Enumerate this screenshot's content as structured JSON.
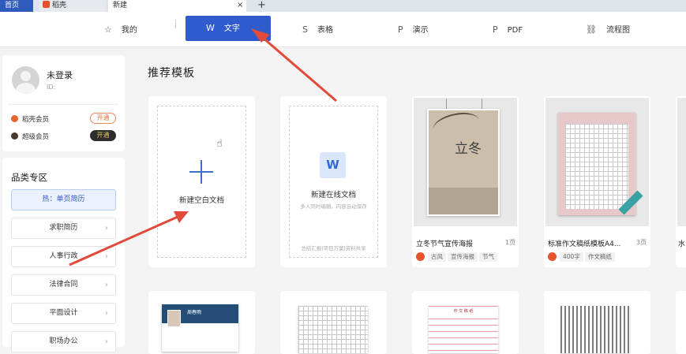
{
  "tabs": [
    {
      "label": "首页"
    },
    {
      "label": "稻壳"
    },
    {
      "label": "新建"
    }
  ],
  "tab_close": "×",
  "tab_add": "+",
  "nav": [
    {
      "label": "我的",
      "icon": "star-icon",
      "glyph": "☆"
    },
    {
      "label": "文字",
      "icon": "writer-icon",
      "glyph": "W",
      "active": true
    },
    {
      "label": "表格",
      "icon": "spreadsheet-icon",
      "glyph": "S"
    },
    {
      "label": "演示",
      "icon": "presentation-icon",
      "glyph": "P"
    },
    {
      "label": "PDF",
      "icon": "pdf-icon",
      "glyph": "P"
    },
    {
      "label": "流程图",
      "icon": "flowchart-icon",
      "glyph": "⛓"
    }
  ],
  "user": {
    "name": "未登录",
    "id_label": "ID:"
  },
  "memberships": [
    {
      "label": "稻壳会员",
      "button": "开通",
      "color": "#e5632d"
    },
    {
      "label": "超级会员",
      "button": "开通",
      "color": "#4a3a2a"
    }
  ],
  "categories": {
    "title": "品类专区",
    "hot": "热：单页简历",
    "items": [
      "求职简历",
      "人事行政",
      "法律合同",
      "平面设计",
      "职场办公"
    ],
    "chevron": "›"
  },
  "section_title": "推荐模板",
  "blank_doc": {
    "label": "新建空白文档"
  },
  "online_doc": {
    "label": "新建在线文档",
    "icon_glyph": "W",
    "subtitle": "多人同时编辑，内容自动保存",
    "footer": "总结汇报|项目方案|资料共享"
  },
  "templates": [
    {
      "name": "立冬节气宣传海报",
      "pages": "1页",
      "tags": [
        "古风",
        "宣传海报",
        "节气"
      ],
      "poster_text": "立冬"
    },
    {
      "name": "标准作文稿纸模板A4...",
      "pages": "3页",
      "tags": [
        "400字",
        "作文稿纸"
      ]
    },
    {
      "name": "水",
      "pages": "",
      "tags": []
    }
  ],
  "bottom_templates": [
    {
      "resume_name": "周春雨"
    },
    {},
    {
      "paper_title": "作 文 稿 纸"
    },
    {}
  ],
  "colors": {
    "accent": "#2f5bcc",
    "arrow": "#e24a3b"
  }
}
